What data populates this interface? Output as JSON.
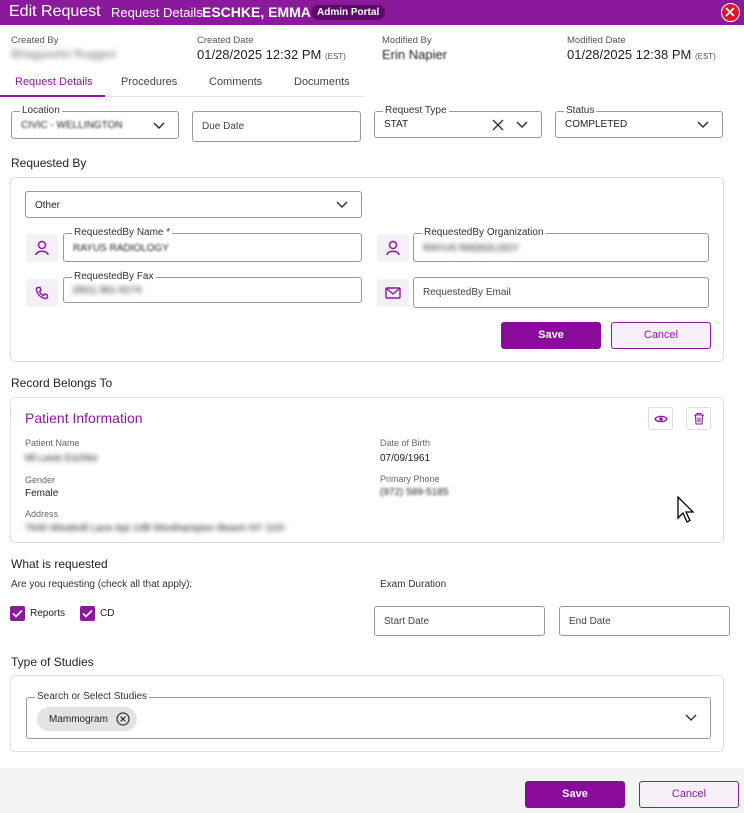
{
  "title_bar": {
    "title": "Edit Request",
    "subtitle_prefix": "Request Details:",
    "patient_name": "ESCHKE, EMMA",
    "badge": "Admin Portal"
  },
  "meta": {
    "created_by": {
      "label": "Created By",
      "value": "Bhagyashri Ruggeri"
    },
    "created_date": {
      "label": "Created Date",
      "value": "01/28/2025 12:32 PM",
      "tz": "(EST)"
    },
    "modified_by": {
      "label": "Modified By",
      "value": "Erin Napier"
    },
    "modified_date": {
      "label": "Modified Date",
      "value": "01/28/2025 12:38 PM",
      "tz": "(EST)"
    }
  },
  "tabs": [
    {
      "label": "Request Details",
      "active": true
    },
    {
      "label": "Procedures"
    },
    {
      "label": "Comments"
    },
    {
      "label": "Documents"
    }
  ],
  "form": {
    "location": {
      "label": "Location",
      "value": "CIVIC - WELLINGTON"
    },
    "due_date": {
      "placeholder": "Due Date"
    },
    "request_type": {
      "label": "Request Type",
      "value": "STAT"
    },
    "status": {
      "label": "Status",
      "value": "COMPLETED"
    }
  },
  "requested_by": {
    "section_title": "Requested By",
    "type_value": "Other",
    "name": {
      "label": "RequestedBy Name *",
      "value": "RAYUS RADIOLOGY"
    },
    "organization": {
      "label": "RequestedBy Organization",
      "value": "RAYUS RADIOLOGY"
    },
    "fax": {
      "label": "RequestedBy Fax",
      "value": "(561) 361-9174"
    },
    "email": {
      "placeholder": "RequestedBy Email"
    },
    "save_label": "Save",
    "cancel_label": "Cancel"
  },
  "record": {
    "section_title": "Record Belongs To",
    "card_title": "Patient Information",
    "patient_name": {
      "label": "Patient Name",
      "value": "Ml Lavie Eschke"
    },
    "dob": {
      "label": "Date of Birth",
      "value": "07/09/1961"
    },
    "gender": {
      "label": "Gender",
      "value": "Female"
    },
    "phone": {
      "label": "Primary Phone",
      "value": "(972) 589-5185"
    },
    "address": {
      "label": "Address",
      "value": "7640 Windmill Lane Apt 14B Westhampton Beach NY 11978"
    }
  },
  "what_requested": {
    "section_title": "What is requested",
    "question": "Are you requesting (check all that apply):",
    "options": [
      {
        "label": "Reports",
        "checked": true
      },
      {
        "label": "CD",
        "checked": true
      }
    ],
    "exam_duration_label": "Exam Duration",
    "start_date_placeholder": "Start Date",
    "end_date_placeholder": "End Date"
  },
  "studies": {
    "section_title": "Type of Studies",
    "search_label": "Search or Select Studies",
    "chips": [
      "Mammogram"
    ]
  },
  "footer": {
    "save_label": "Save",
    "cancel_label": "Cancel"
  },
  "colors": {
    "brand": "#8a1a9b",
    "close": "#e0142d"
  }
}
